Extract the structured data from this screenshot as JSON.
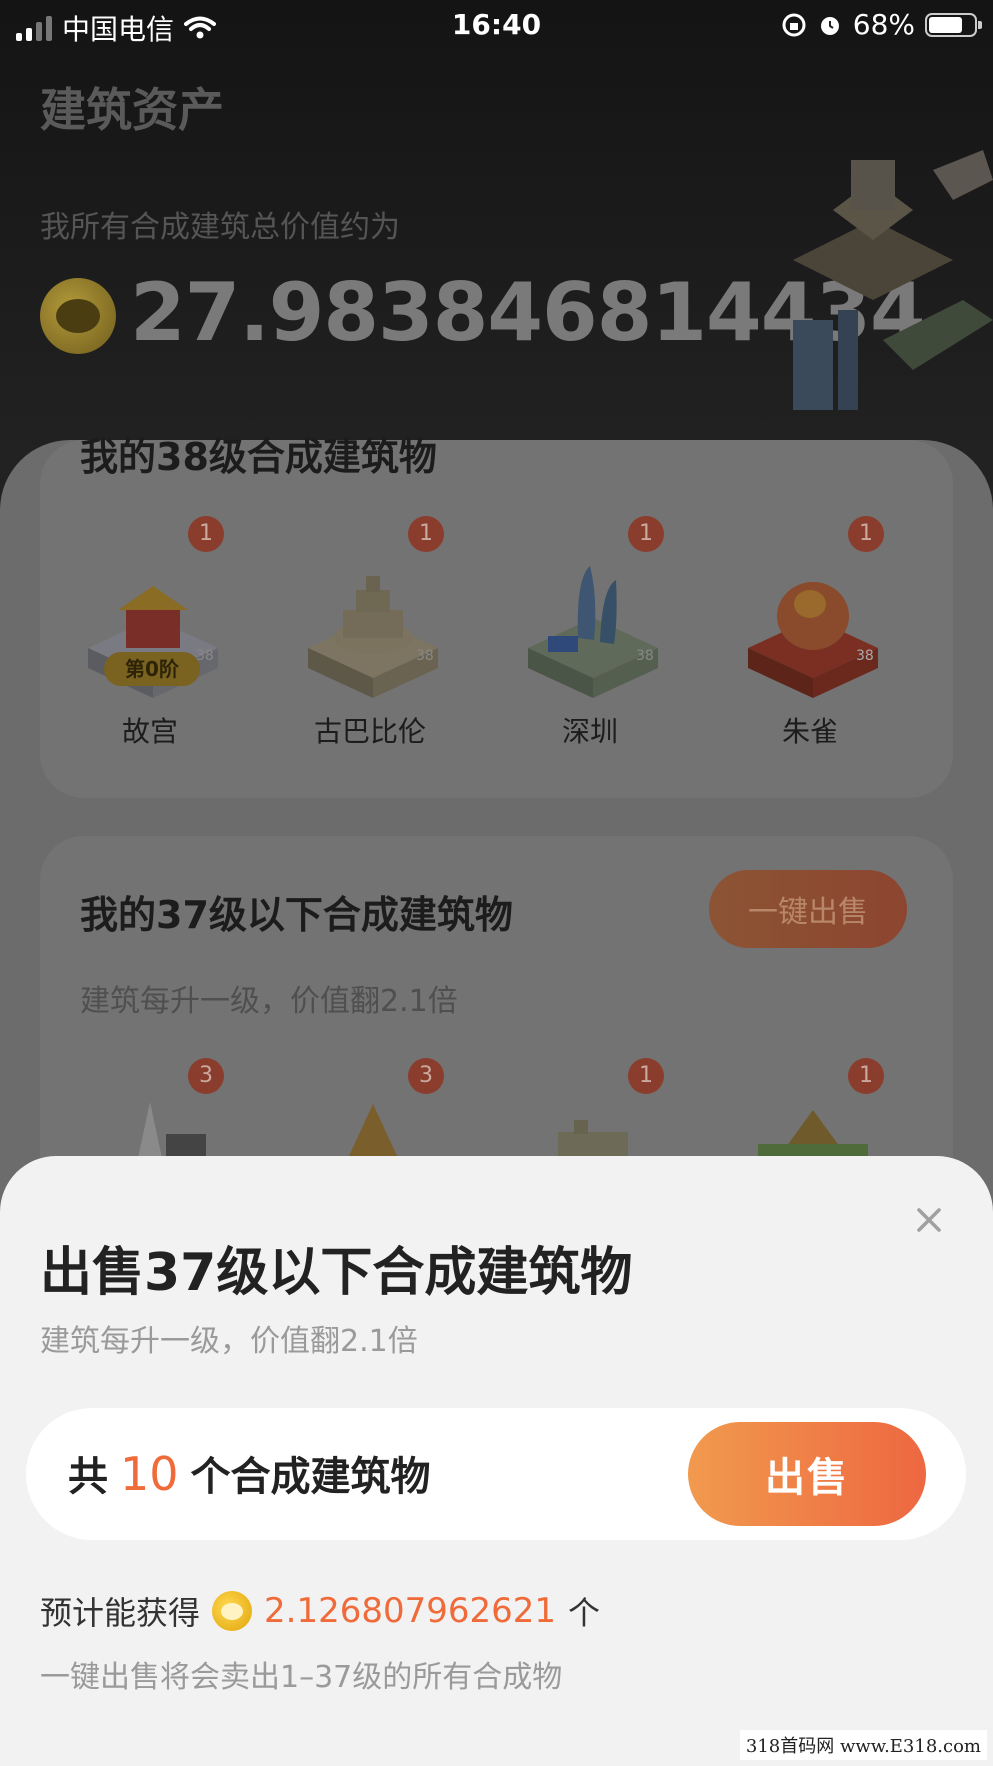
{
  "status_bar": {
    "carrier": "中国电信",
    "time": "16:40",
    "battery": "68%",
    "battery_level": 0.68
  },
  "hero": {
    "title": "建筑资产",
    "subtitle": "我所有合成建筑总价值约为",
    "total_value": "27.983846814434",
    "coin_icon": "panda-coin-icon"
  },
  "card_38": {
    "title": "我的38级合成建筑物",
    "items": [
      {
        "name": "故宫",
        "count": "1",
        "level": "38",
        "stage": "第0阶",
        "color": "#b8423a"
      },
      {
        "name": "古巴比伦",
        "count": "1",
        "level": "38",
        "color": "#d8c79a"
      },
      {
        "name": "深圳",
        "count": "1",
        "level": "38",
        "color": "#4a8ad8"
      },
      {
        "name": "朱雀",
        "count": "1",
        "level": "38",
        "color": "#e04a2a"
      }
    ]
  },
  "card_37": {
    "title": "我的37级以下合成建筑物",
    "subtitle": "建筑每升一级，价值翻2.1倍",
    "sell_all_label": "一键出售",
    "badges": [
      "3",
      "3",
      "1",
      "1"
    ]
  },
  "sheet": {
    "close_icon": "close-icon",
    "title": "出售37级以下合成建筑物",
    "subtitle": "建筑每升一级，价值翻2.1倍",
    "count_prefix": "共",
    "count": "10",
    "count_suffix": "个合成建筑物",
    "sell_label": "出售",
    "earn_prefix": "预计能获得",
    "earn_value": "2.126807962621",
    "earn_suffix": "个",
    "note": "一键出售将会卖出1–37级的所有合成物"
  },
  "watermark": "318首码网  www.E318.com"
}
